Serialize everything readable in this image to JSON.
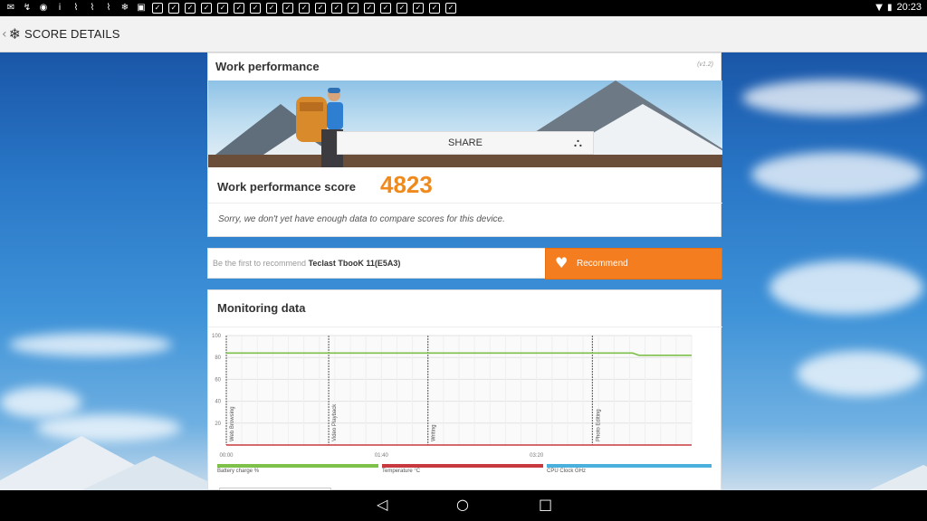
{
  "status_bar": {
    "time": "20:23",
    "left_icons": [
      "gmail-icon",
      "app-icon",
      "podcast-icon",
      "info-icon",
      "shoe-icon",
      "shoe-icon",
      "shoe-icon",
      "snowflake-icon",
      "image-icon",
      "box-icon",
      "box-icon",
      "box-icon",
      "box-icon",
      "box-icon",
      "box-icon",
      "box-icon",
      "box-icon",
      "box-icon",
      "box-icon",
      "box-icon",
      "box-icon",
      "box-icon",
      "box-icon",
      "box-icon",
      "box-icon",
      "box-icon",
      "box-icon",
      "box-icon"
    ],
    "right_icons": [
      "wifi-icon",
      "battery-icon"
    ]
  },
  "app_bar": {
    "title": "SCORE DETAILS",
    "back_icon": "chevron-left-icon",
    "logo_icon": "snowflake-logo-icon"
  },
  "work_performance": {
    "title": "Work performance",
    "version": "(v1.2)",
    "share_label": "SHARE",
    "score_label": "Work performance score",
    "score_value": "4823",
    "score_color": "#f08a1c",
    "compare_note": "Sorry, we don't yet have enough data to compare scores for this device."
  },
  "recommend": {
    "prefix": "Be the first to recommend",
    "device": "Teclast TbooK 11(E5A3)",
    "button_label": "Recommend",
    "button_color": "#f47d20"
  },
  "monitoring": {
    "title": "Monitoring data",
    "legend": [
      {
        "label": "Battery charge %",
        "color": "#7dc04a"
      },
      {
        "label": "Temperature °C",
        "color": "#c8393f"
      },
      {
        "label": "CPU Clock GHz",
        "color": "#4ab0dd"
      }
    ]
  },
  "chart_data": {
    "type": "line",
    "ylim": [
      0,
      100
    ],
    "y_ticks": [
      "100",
      "80",
      "60",
      "40",
      "20"
    ],
    "x_ticks": [
      "00:00",
      "01:40",
      "03:20"
    ],
    "x_range_seconds": [
      0,
      300
    ],
    "sections": [
      {
        "label": "Web Browsing",
        "start": "00:00"
      },
      {
        "label": "Video Playback",
        "start": "01:06"
      },
      {
        "label": "Writing",
        "start": "02:10"
      },
      {
        "label": "Photo Editing",
        "start": "03:56"
      }
    ],
    "series": [
      {
        "name": "Battery charge %",
        "color": "#7dc04a",
        "x": [
          0,
          262,
          266,
          300
        ],
        "y": [
          84,
          84,
          82,
          82
        ]
      },
      {
        "name": "Temperature °C",
        "color": "#c8393f",
        "x": [
          0,
          300
        ],
        "y": [
          0,
          0
        ]
      }
    ],
    "grid": true
  },
  "nav_bar": {
    "back_icon": "back-triangle-icon",
    "home_icon": "home-circle-icon",
    "recents_icon": "recents-square-icon"
  }
}
